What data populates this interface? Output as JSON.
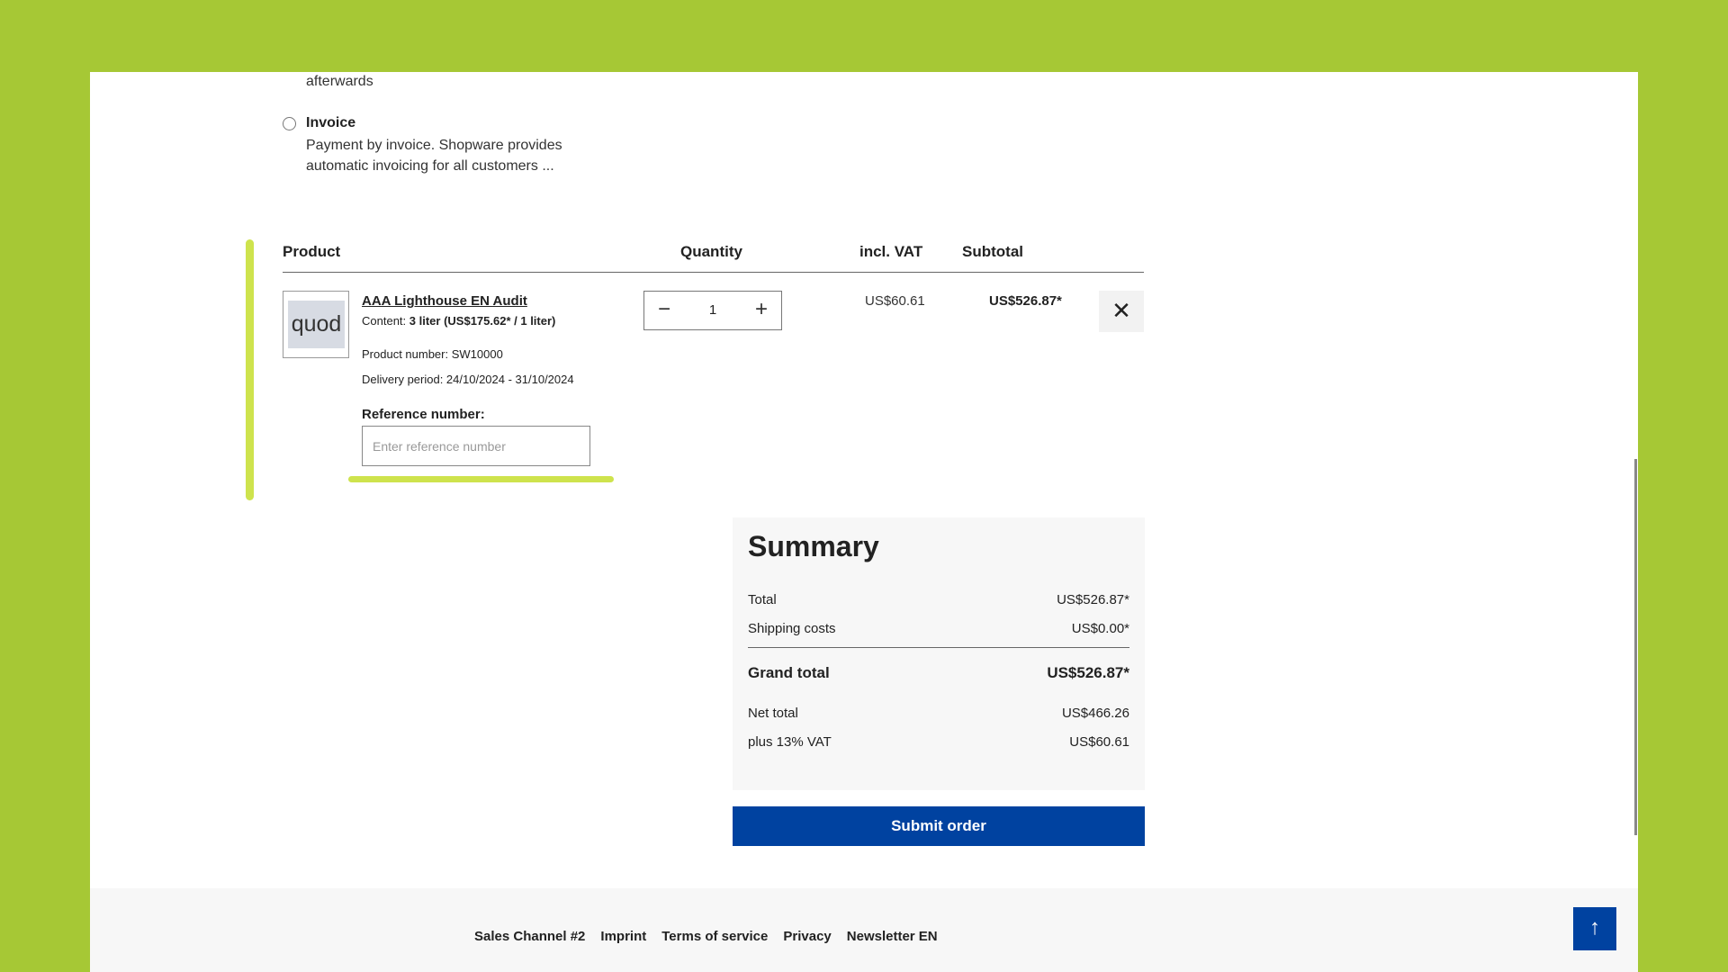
{
  "payment": {
    "previous_tail": "afterwards",
    "invoice": {
      "title": "Invoice",
      "description": "Payment by invoice. Shopware provides automatic invoicing for all customers ..."
    }
  },
  "cart": {
    "headers": {
      "product": "Product",
      "quantity": "Quantity",
      "vat": "incl. VAT",
      "subtotal": "Subtotal"
    },
    "item": {
      "thumbnail_text": "quod",
      "name": "AAA Lighthouse EN Audit",
      "content_label": "Content:",
      "content_value": "3 liter (US$175.62* / 1 liter)",
      "product_number": "Product number: SW10000",
      "delivery_period": "Delivery period: 24/10/2024 - 31/10/2024",
      "reference_label": "Reference number:",
      "reference_placeholder": "Enter reference number",
      "reference_value": "",
      "quantity": "1",
      "vat_price": "US$60.61",
      "subtotal": "US$526.87*"
    }
  },
  "summary": {
    "title": "Summary",
    "total_label": "Total",
    "total_value": "US$526.87*",
    "shipping_label": "Shipping costs",
    "shipping_value": "US$0.00*",
    "grand_label": "Grand total",
    "grand_value": "US$526.87*",
    "net_label": "Net total",
    "net_value": "US$466.26",
    "vat_label": "plus 13% VAT",
    "vat_value": "US$60.61"
  },
  "submit_label": "Submit order",
  "footer": {
    "links": [
      "Sales Channel #2",
      "Imprint",
      "Terms of service",
      "Privacy",
      "Newsletter EN"
    ]
  },
  "icons": {
    "minus": "minus-icon",
    "plus": "plus-icon",
    "close": "close-icon",
    "arrow_up": "arrow-up-icon"
  },
  "colors": {
    "frame": "#a6c835",
    "accent": "#0042a0",
    "highlight": "#c9e03a"
  }
}
